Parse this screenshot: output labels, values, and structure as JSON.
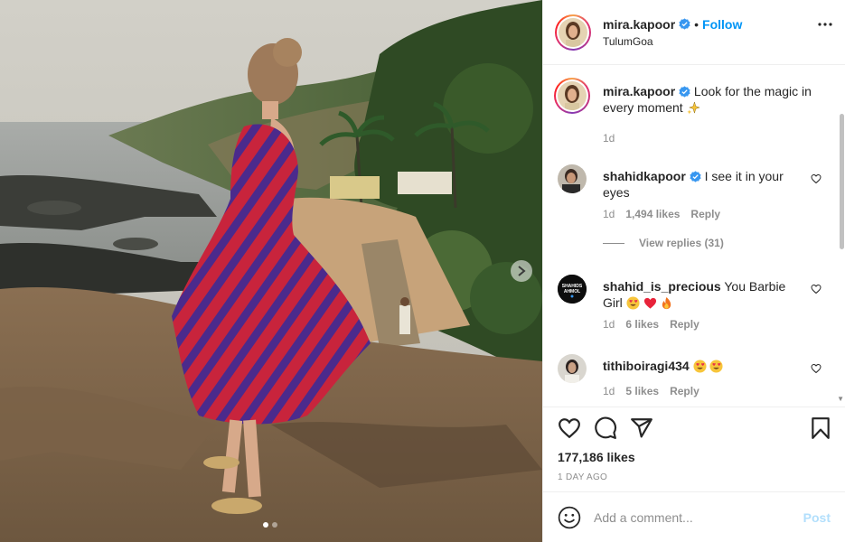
{
  "post": {
    "username": "mira.kapoor",
    "separator": "•",
    "follow_label": "Follow",
    "location": "TulumGoa",
    "more_icon": "more-horizontal-icon",
    "photo_icons": {
      "next": "chevron-right-icon"
    },
    "carousel": {
      "count": 2,
      "active": 0
    }
  },
  "caption": {
    "username": "mira.kapoor",
    "text": "Look for the magic in every moment",
    "emoji": "sparkles",
    "time": "1d"
  },
  "comments": [
    {
      "username": "shahidkapoor",
      "verified": true,
      "text": "I see it in your eyes",
      "time": "1d",
      "likes": "1,494 likes",
      "reply": "Reply",
      "view_replies": "View replies (31)"
    },
    {
      "username": "shahid_is_precious",
      "verified": false,
      "text": "You Barbie Girl",
      "emojis": [
        "heart-eyes",
        "red-heart",
        "fire"
      ],
      "time": "1d",
      "likes": "6 likes",
      "reply": "Reply",
      "avatar_text": [
        "SHAHIDS",
        "AHMOL"
      ]
    },
    {
      "username": "tithiboiragi434",
      "verified": false,
      "text": "",
      "emojis": [
        "heart-eyes",
        "heart-eyes"
      ],
      "time": "1d",
      "likes": "5 likes",
      "reply": "Reply"
    }
  ],
  "actions": {
    "icons": [
      "heart-icon",
      "comment-icon",
      "share-icon",
      "bookmark-icon"
    ],
    "likes": "177,186 likes",
    "posted_ago": "1 DAY AGO"
  },
  "composer": {
    "placeholder": "Add a comment...",
    "post_label": "Post"
  },
  "colors": {
    "accent": "#0095f6",
    "muted": "#8e8e8e",
    "post_disabled": "#b2dffc",
    "verified": "#3897f0"
  }
}
